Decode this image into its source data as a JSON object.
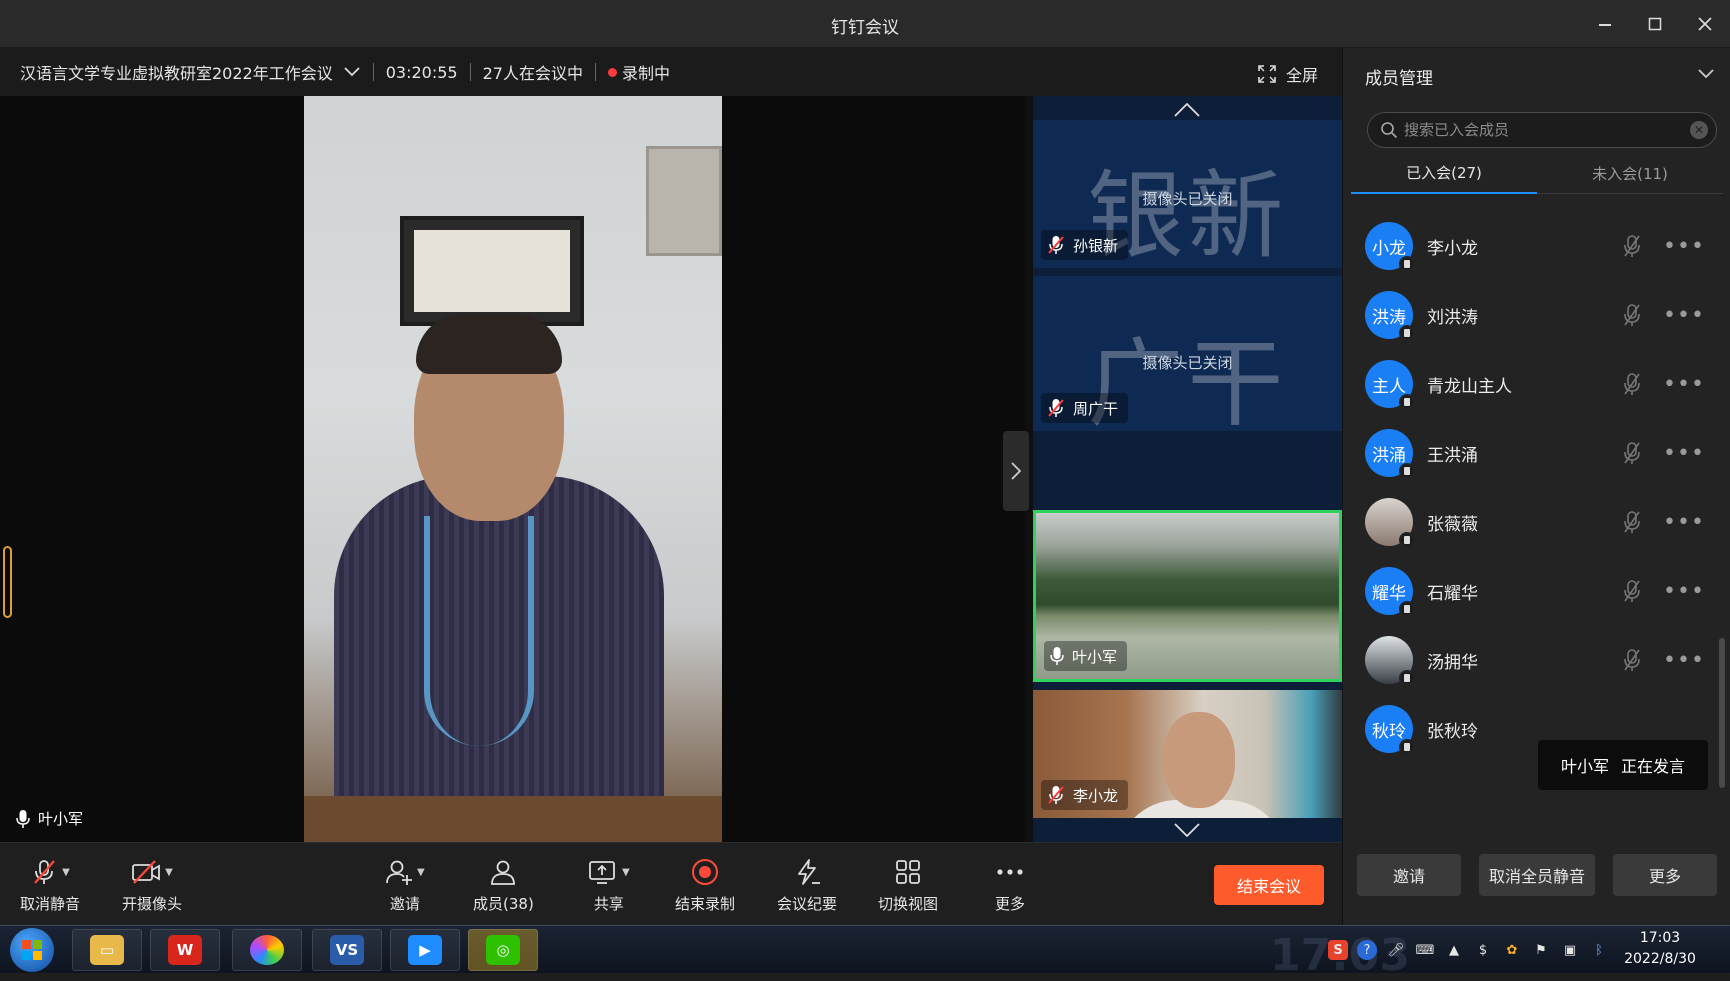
{
  "window": {
    "title": "钉钉会议",
    "minimize": "—",
    "maximize": "☐",
    "close": "✕"
  },
  "meeting": {
    "title": "汉语言文学专业虚拟教研室2022年工作会议",
    "duration": "03:20:55",
    "attendees": "27人在会议中",
    "recording": "录制中",
    "fullscreen": "全屏"
  },
  "main_speaker": {
    "name": "叶小军"
  },
  "thumbnails": [
    {
      "name": "孙银新",
      "big_text": "银新",
      "status": "摄像头已关闭",
      "camera": "off",
      "muted": true
    },
    {
      "name": "周广干",
      "big_text": "广干",
      "status": "摄像头已关闭",
      "camera": "off",
      "muted": true
    },
    {
      "name": "叶小军",
      "camera": "on",
      "muted": false,
      "active": true
    },
    {
      "name": "李小龙",
      "camera": "on",
      "muted": true
    }
  ],
  "toolbar": {
    "unmute": "取消静音",
    "camera": "开摄像头",
    "invite": "邀请",
    "members": "成员(38)",
    "share": "共享",
    "stop_record": "结束录制",
    "minutes": "会议纪要",
    "switch_view": "切换视图",
    "more": "更多",
    "end_meeting": "结束会议"
  },
  "panel": {
    "title": "成员管理",
    "search_placeholder": "搜索已入会成员",
    "tab_joined": "已入会(27)",
    "tab_not_joined": "未入会(11)",
    "members": [
      {
        "avatar": "小龙",
        "name": "李小龙"
      },
      {
        "avatar": "洪涛",
        "name": "刘洪涛"
      },
      {
        "avatar": "主人",
        "name": "青龙山主人"
      },
      {
        "avatar": "洪涌",
        "name": "王洪涌"
      },
      {
        "avatar": "",
        "name": "张薇薇"
      },
      {
        "avatar": "耀华",
        "name": "石耀华"
      },
      {
        "avatar": "",
        "name": "汤拥华"
      },
      {
        "avatar": "秋玲",
        "name": "张秋玲"
      }
    ],
    "speaking_name": "叶小军",
    "speaking_text": "正在发言",
    "btn_invite": "邀请",
    "btn_unmute_all": "取消全员静音",
    "btn_more": "更多"
  },
  "taskbar": {
    "time": "17:03",
    "date": "2022/8/30",
    "ghost_clock": "17:03",
    "apps": [
      "file-explorer",
      "wps",
      "browser",
      "vs",
      "dingtalk-meeting",
      "wechat"
    ]
  },
  "colors": {
    "accent": "#1f8cff",
    "end_button": "#ff5a2c",
    "active_border": "#2fd25a",
    "recording": "#ff3b3b"
  }
}
